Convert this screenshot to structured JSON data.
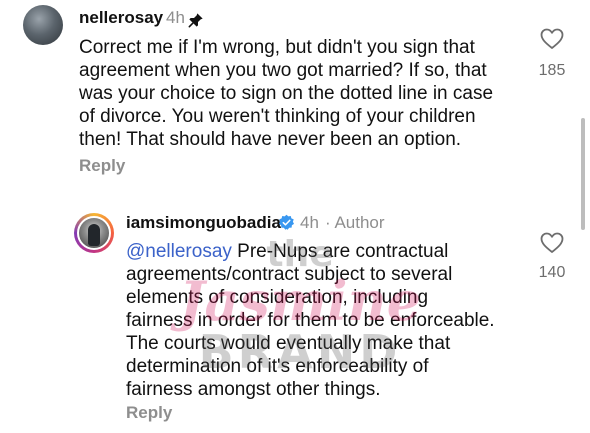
{
  "comment1": {
    "username": "nellerosay",
    "time": "4h",
    "text": "Correct me if I'm wrong, but didn't you sign that agreement when you two got married? If so, that was your choice to sign on the dotted line in case of divorce. You weren't thinking of your children then! That should have never been an option.",
    "lines": [
      "Correct me if I'm wrong, but didn't you sign that",
      "agreement when you two got married? If so, that",
      "was your choice to sign on the dotted line in case",
      "of divorce. You weren't thinking of your children",
      "then! That should have never been an option."
    ],
    "reply_label": "Reply",
    "likes": "185"
  },
  "comment2": {
    "username": "iamsimonguobadia",
    "time": "4h",
    "author_label": "· Author",
    "mention": "@nellerosay",
    "lines": [
      " Pre-Nups are contractual",
      "agreements/contract subject to several",
      "elements of consideration, including",
      "fairness in order for them to be enforceable.",
      "The courts would eventually make that",
      "determination of it's enforceability of",
      "fairness amongst other things."
    ],
    "reply_label": "Reply",
    "likes": "140"
  },
  "watermark": {
    "line1": "the",
    "line2": "Jasmine",
    "line3": "BRAND"
  },
  "colors": {
    "mention": "#3b62c9",
    "verified": "#3897f0",
    "muted": "#8e8e8e"
  }
}
